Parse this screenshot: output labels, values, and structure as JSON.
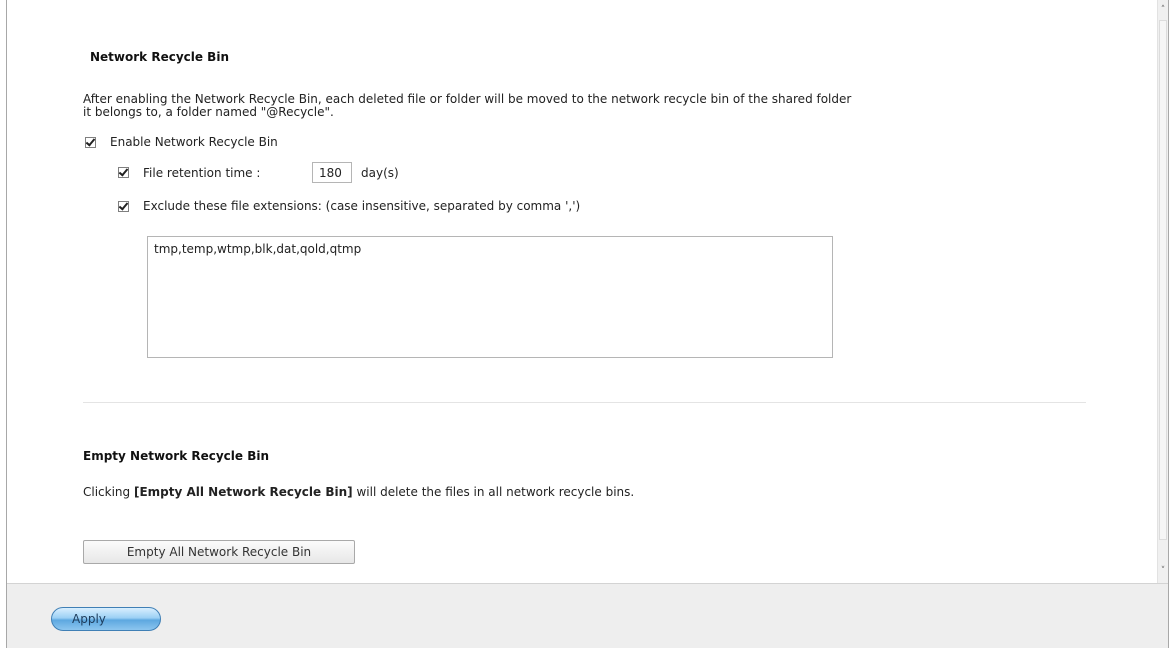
{
  "recycle_bin": {
    "title": "Network Recycle Bin",
    "description_line1": "After enabling the Network Recycle Bin, each deleted file or folder will be moved to the network recycle bin of the shared folder",
    "description_line2": "it belongs to, a folder named \"@Recycle\".",
    "enable_label": "Enable Network Recycle Bin",
    "enable_checked": true,
    "retention_label": "File retention time :",
    "retention_checked": true,
    "retention_value": "180",
    "retention_unit": "day(s)",
    "exclude_label": "Exclude these file extensions: (case insensitive, separated by comma ',')",
    "exclude_checked": true,
    "exclude_value": "tmp,temp,wtmp,blk,dat,qold,qtmp"
  },
  "empty_section": {
    "title": "Empty Network Recycle Bin",
    "desc_prefix": "Clicking ",
    "desc_bold": "[Empty All Network Recycle Bin]",
    "desc_suffix": " will delete the files in all network recycle bins.",
    "button_label": "Empty All Network Recycle Bin"
  },
  "footer": {
    "apply_label": "Apply"
  },
  "scrollbar": {
    "up_icon": "chevron-up-icon",
    "down_icon": "chevron-down-icon"
  }
}
